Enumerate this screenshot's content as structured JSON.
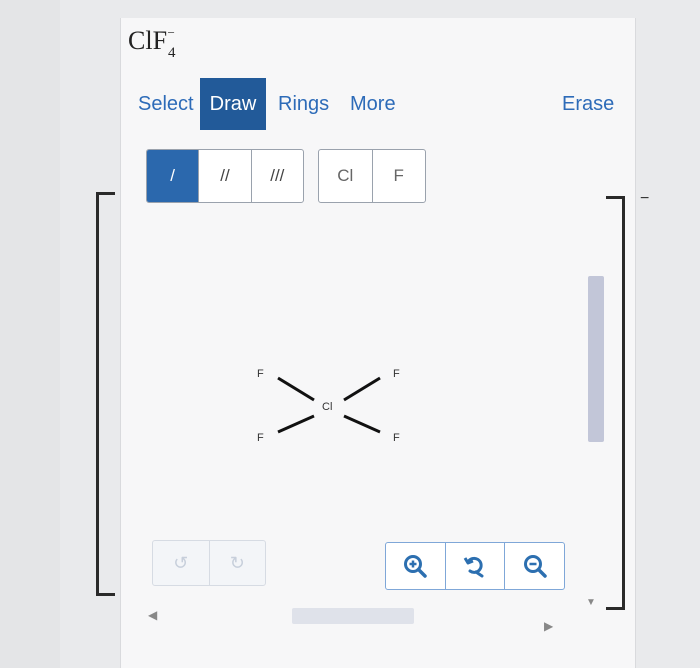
{
  "question": {
    "formula_main": "ClF",
    "formula_subscript": "4",
    "formula_superscript": "−"
  },
  "toolbar": {
    "tabs": [
      {
        "label": "Select",
        "active": false
      },
      {
        "label": "Draw",
        "active": true
      },
      {
        "label": "Rings",
        "active": false
      },
      {
        "label": "More",
        "active": false
      }
    ],
    "erase_label": "Erase"
  },
  "bond_tools": [
    {
      "name": "single-bond",
      "glyph": "/",
      "active": true
    },
    {
      "name": "double-bond",
      "glyph": "//",
      "active": false
    },
    {
      "name": "triple-bond",
      "glyph": "///",
      "active": false
    }
  ],
  "atom_tools": [
    "Cl",
    "F"
  ],
  "canvas": {
    "charge": "−",
    "molecule": {
      "central": "Cl",
      "ligands": [
        "F",
        "F",
        "F",
        "F"
      ]
    }
  },
  "colors": {
    "accent": "#225a99",
    "link": "#2d6bb8",
    "bond_active": "#2b68ad",
    "zoom_icon": "#2c6fb0"
  },
  "icons": {
    "undo": "undo-icon",
    "redo": "redo-icon",
    "zoom_in": "zoom-in-icon",
    "reset_zoom": "reset-zoom-icon",
    "zoom_out": "zoom-out-icon"
  }
}
